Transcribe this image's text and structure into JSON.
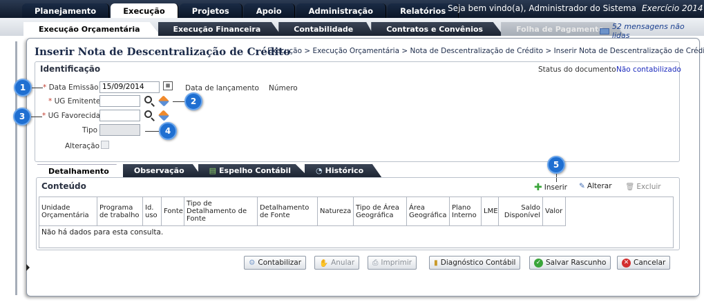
{
  "topnav": {
    "tabs": [
      "Planejamento",
      "Execução",
      "Projetos",
      "Apoio",
      "Administração",
      "Relatórios"
    ],
    "active": "Execução"
  },
  "welcome": "Seja bem vindo(a), Administrador do Sistema",
  "exercicio": "Exercício 2014",
  "subnav": {
    "tabs": [
      "Execução Orçamentária",
      "Execução Financeira",
      "Contabilidade",
      "Contratos e Convênios",
      "Folha de Pagamento"
    ]
  },
  "messages": "52 mensagens não lidas",
  "page": {
    "title": "Inserir Nota de Descentralização de Crédito",
    "breadcrumb": "Execução > Execução Orçamentária > Nota de Descentralização de Crédito > Inserir Nota de Descentralização de Crédito"
  },
  "identificacao": {
    "heading": "Identificação",
    "status_label": "Status do documento",
    "status_value": "Não contabilizado",
    "data_emissao_label": "Data Emissão",
    "data_emissao_value": "15/09/2014",
    "data_lancamento_label": "Data de lançamento",
    "numero_label": "Número",
    "ug_emitente_label": "UG Emitente",
    "ug_favorecida_label": "UG Favorecida",
    "tipo_label": "Tipo",
    "alteracao_label": "Alteração",
    "required_mark": "*"
  },
  "callouts": [
    "1",
    "2",
    "3",
    "4",
    "5"
  ],
  "detail_tabs": [
    "Detalhamento",
    "Observação",
    "Espelho Contábil",
    "Histórico"
  ],
  "conteudo": {
    "heading": "Conteúdo",
    "actions": {
      "inserir": "Inserir",
      "alterar": "Alterar",
      "excluir": "Excluir"
    },
    "columns": [
      "Unidade Orçamentária",
      "Programa de trabalho",
      "Id. uso",
      "Fonte",
      "Tipo de Detalhamento de Fonte",
      "Detalhamento de Fonte",
      "Natureza",
      "Tipo de Área Geográfica",
      "Área Geográfica",
      "Plano Interno",
      "LME",
      "Saldo Disponível",
      "Valor"
    ],
    "empty": "Não há dados para esta consulta."
  },
  "buttons": {
    "contabilizar": "Contabilizar",
    "anular": "Anular",
    "imprimir": "Imprimir",
    "diagnostico": "Diagnóstico Contábil",
    "salvar": "Salvar Rascunho",
    "cancelar": "Cancelar"
  },
  "colors": {
    "callout": "#1f6fd1",
    "status_value": "#1c2bbd",
    "topbar": "#0f1a2c"
  }
}
